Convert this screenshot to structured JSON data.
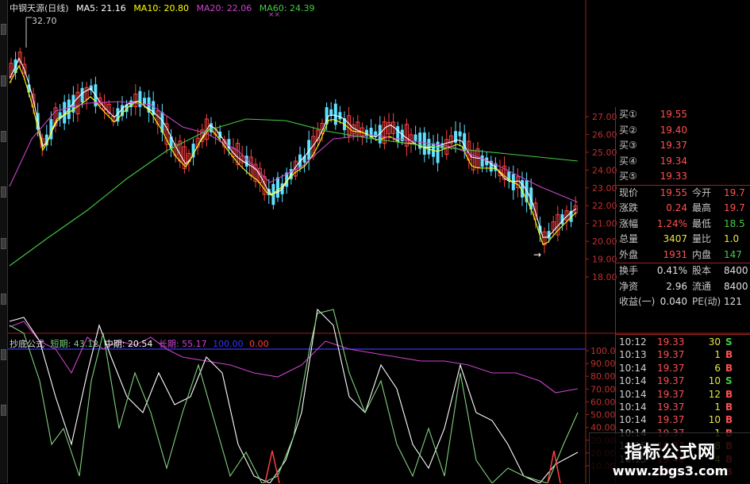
{
  "header": {
    "title": "中钢天源(日线)",
    "ma5": "MA5: 21.16",
    "ma10": "MA10: 20.80",
    "ma20": "MA20: 22.06",
    "ma60": "MA60: 24.39",
    "marker": "××",
    "high_annotation": "32.70",
    "colors": {
      "ma5": "#ffffff",
      "ma10": "#ffff00",
      "ma20": "#cc44cc",
      "ma60": "#44cc44"
    }
  },
  "price_axis": [
    "27.00",
    "26.00",
    "25.00",
    "24.00",
    "23.00",
    "22.00",
    "21.00",
    "20.00",
    "19.00",
    "18.00"
  ],
  "indicator": {
    "name": "抄底公式",
    "short": "短期: 43.12",
    "mid": "中期: 20.54",
    "long": "长期: 55.17",
    "ref": "100.00",
    "zero": "0.00",
    "axis": [
      "100.0",
      "90.00",
      "80.00",
      "70.00",
      "60.00",
      "50.00",
      "40.00",
      "30.00",
      "20.00",
      "10.00"
    ],
    "colors": {
      "short": "#7fd07f",
      "mid": "#ffffff",
      "long": "#cc44cc",
      "ref": "#3333ff",
      "zero": "#ff4040"
    }
  },
  "order_book": [
    {
      "label": "买①",
      "price": "19.55"
    },
    {
      "label": "买②",
      "price": "19.40"
    },
    {
      "label": "买③",
      "price": "19.37"
    },
    {
      "label": "买④",
      "price": "19.34"
    },
    {
      "label": "买⑤",
      "price": "19.33"
    }
  ],
  "quote": [
    {
      "l": "现价",
      "v": "19.55",
      "vc": "#ff5050",
      "l2": "今开",
      "v2": "19.7",
      "v2c": "#ff5050"
    },
    {
      "l": "涨跌",
      "v": "0.24",
      "vc": "#ff5050",
      "l2": "最高",
      "v2": "19.7",
      "v2c": "#ff5050"
    },
    {
      "l": "涨幅",
      "v": "1.24%",
      "vc": "#ff5050",
      "l2": "最低",
      "v2": "18.5",
      "v2c": "#44cc44"
    },
    {
      "l": "总量",
      "v": "3407",
      "vc": "#e8e843",
      "l2": "量比",
      "v2": "1.0",
      "v2c": "#e8e843"
    },
    {
      "l": "外盘",
      "v": "1931",
      "vc": "#ff5050",
      "l2": "内盘",
      "v2": "147",
      "v2c": "#44cc44"
    }
  ],
  "fundamentals": [
    {
      "l": "换手",
      "v": "0.41%",
      "l2": "股本",
      "v2": "8400"
    },
    {
      "l": "净资",
      "v": "2.96",
      "l2": "流通",
      "v2": "8400"
    },
    {
      "l": "收益(一)",
      "v": "0.040",
      "l2": "PE(动)",
      "v2": "121"
    }
  ],
  "trades": [
    {
      "time": "10:12",
      "price": "19.33",
      "vol": "30",
      "side": "S"
    },
    {
      "time": "10:13",
      "price": "19.37",
      "vol": "1",
      "side": "B"
    },
    {
      "time": "10:14",
      "price": "19.37",
      "vol": "6",
      "side": "B"
    },
    {
      "time": "10:14",
      "price": "19.37",
      "vol": "10",
      "side": "S"
    },
    {
      "time": "10:14",
      "price": "19.37",
      "vol": "12",
      "side": "B"
    },
    {
      "time": "10:14",
      "price": "19.37",
      "vol": "1",
      "side": "B"
    },
    {
      "time": "10:14",
      "price": "19.37",
      "vol": "10",
      "side": "B"
    },
    {
      "time": "10:14",
      "price": "19.37",
      "vol": "1",
      "side": "B"
    },
    {
      "time": "10:15",
      "price": "19.37",
      "vol": "8",
      "side": "B"
    },
    {
      "time": "10:15",
      "price": "19.40",
      "vol": "4",
      "side": "B"
    },
    {
      "time": "10:15",
      "price": "19.50",
      "vol": "8",
      "side": "B"
    }
  ],
  "watermark": {
    "line1": "指标公式网",
    "line2": "www.zbgs3.com"
  }
}
